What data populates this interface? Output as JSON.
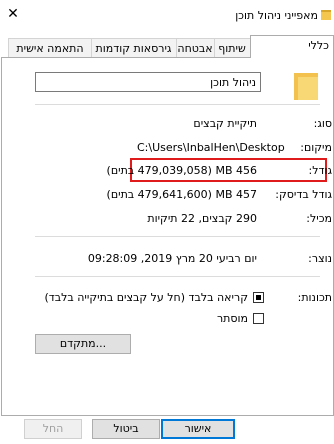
{
  "window": {
    "title": "מאפייני ניהול תוכן",
    "close_glyph": "✕"
  },
  "tabs": [
    "כללי",
    "שיתוף",
    "אבטחה",
    "גירסאות קודמות",
    "התאמה אישית"
  ],
  "general": {
    "folder_name": "ניהול תוכן",
    "type_label": "סוג:",
    "type_value": "תיקיית קבצים",
    "location_label": "מיקום:",
    "location_value": "C:\\Users\\InbalHen\\Desktop",
    "size_label": "גודל:",
    "size_value": "456 MB (479,039,058 בתים)",
    "size_on_disk_label": "גודל בדיסק:",
    "size_on_disk_value": "457 MB (479,641,600 בתים)",
    "contains_label": "מכיל:",
    "contains_value": "290 קבצים, 22 תיקיות",
    "created_label": "נוצר:",
    "created_value": "יום רביעי 20 מרץ 2019, 09:28:09",
    "attributes_label": "תכונות:",
    "readonly_label": "קריאה בלבד (חל על קבצים בתיקייה בלבד)",
    "readonly_checked": "partial",
    "hidden_label": "מוסתר",
    "hidden_checked": false,
    "advanced_button": "מתקדם..."
  },
  "footer": {
    "ok": "אישור",
    "cancel": "ביטול",
    "apply": "החל"
  },
  "colors": {
    "highlight_border": "#e01b1b",
    "primary_button_border": "#0078d7",
    "folder": "#f2c14e"
  }
}
